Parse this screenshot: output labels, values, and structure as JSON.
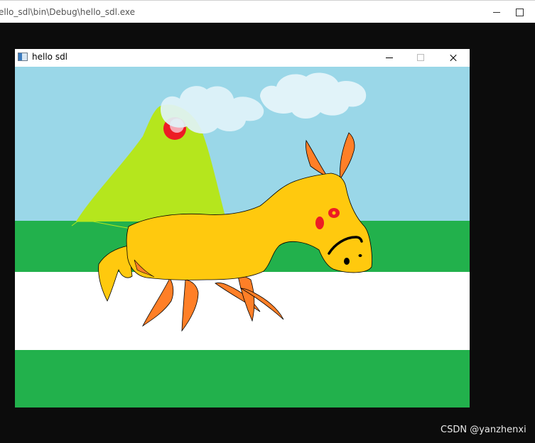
{
  "console": {
    "title": "ello_sdl\\bin\\Debug\\hello_sdl.exe"
  },
  "sdl_window": {
    "title": "hello sdl"
  },
  "scene": {
    "colors": {
      "sky": "#9ad7e8",
      "grass": "#22b14c",
      "road": "#ffffff",
      "mountain": "#b5e61d",
      "sun": "#ed1c24",
      "cloud": "#e1f3f9",
      "horse_body": "#ffc90e",
      "horse_legs": "#ff7f27",
      "eye": "#ed1c24"
    }
  },
  "watermark": "CSDN @yanzhenxi"
}
